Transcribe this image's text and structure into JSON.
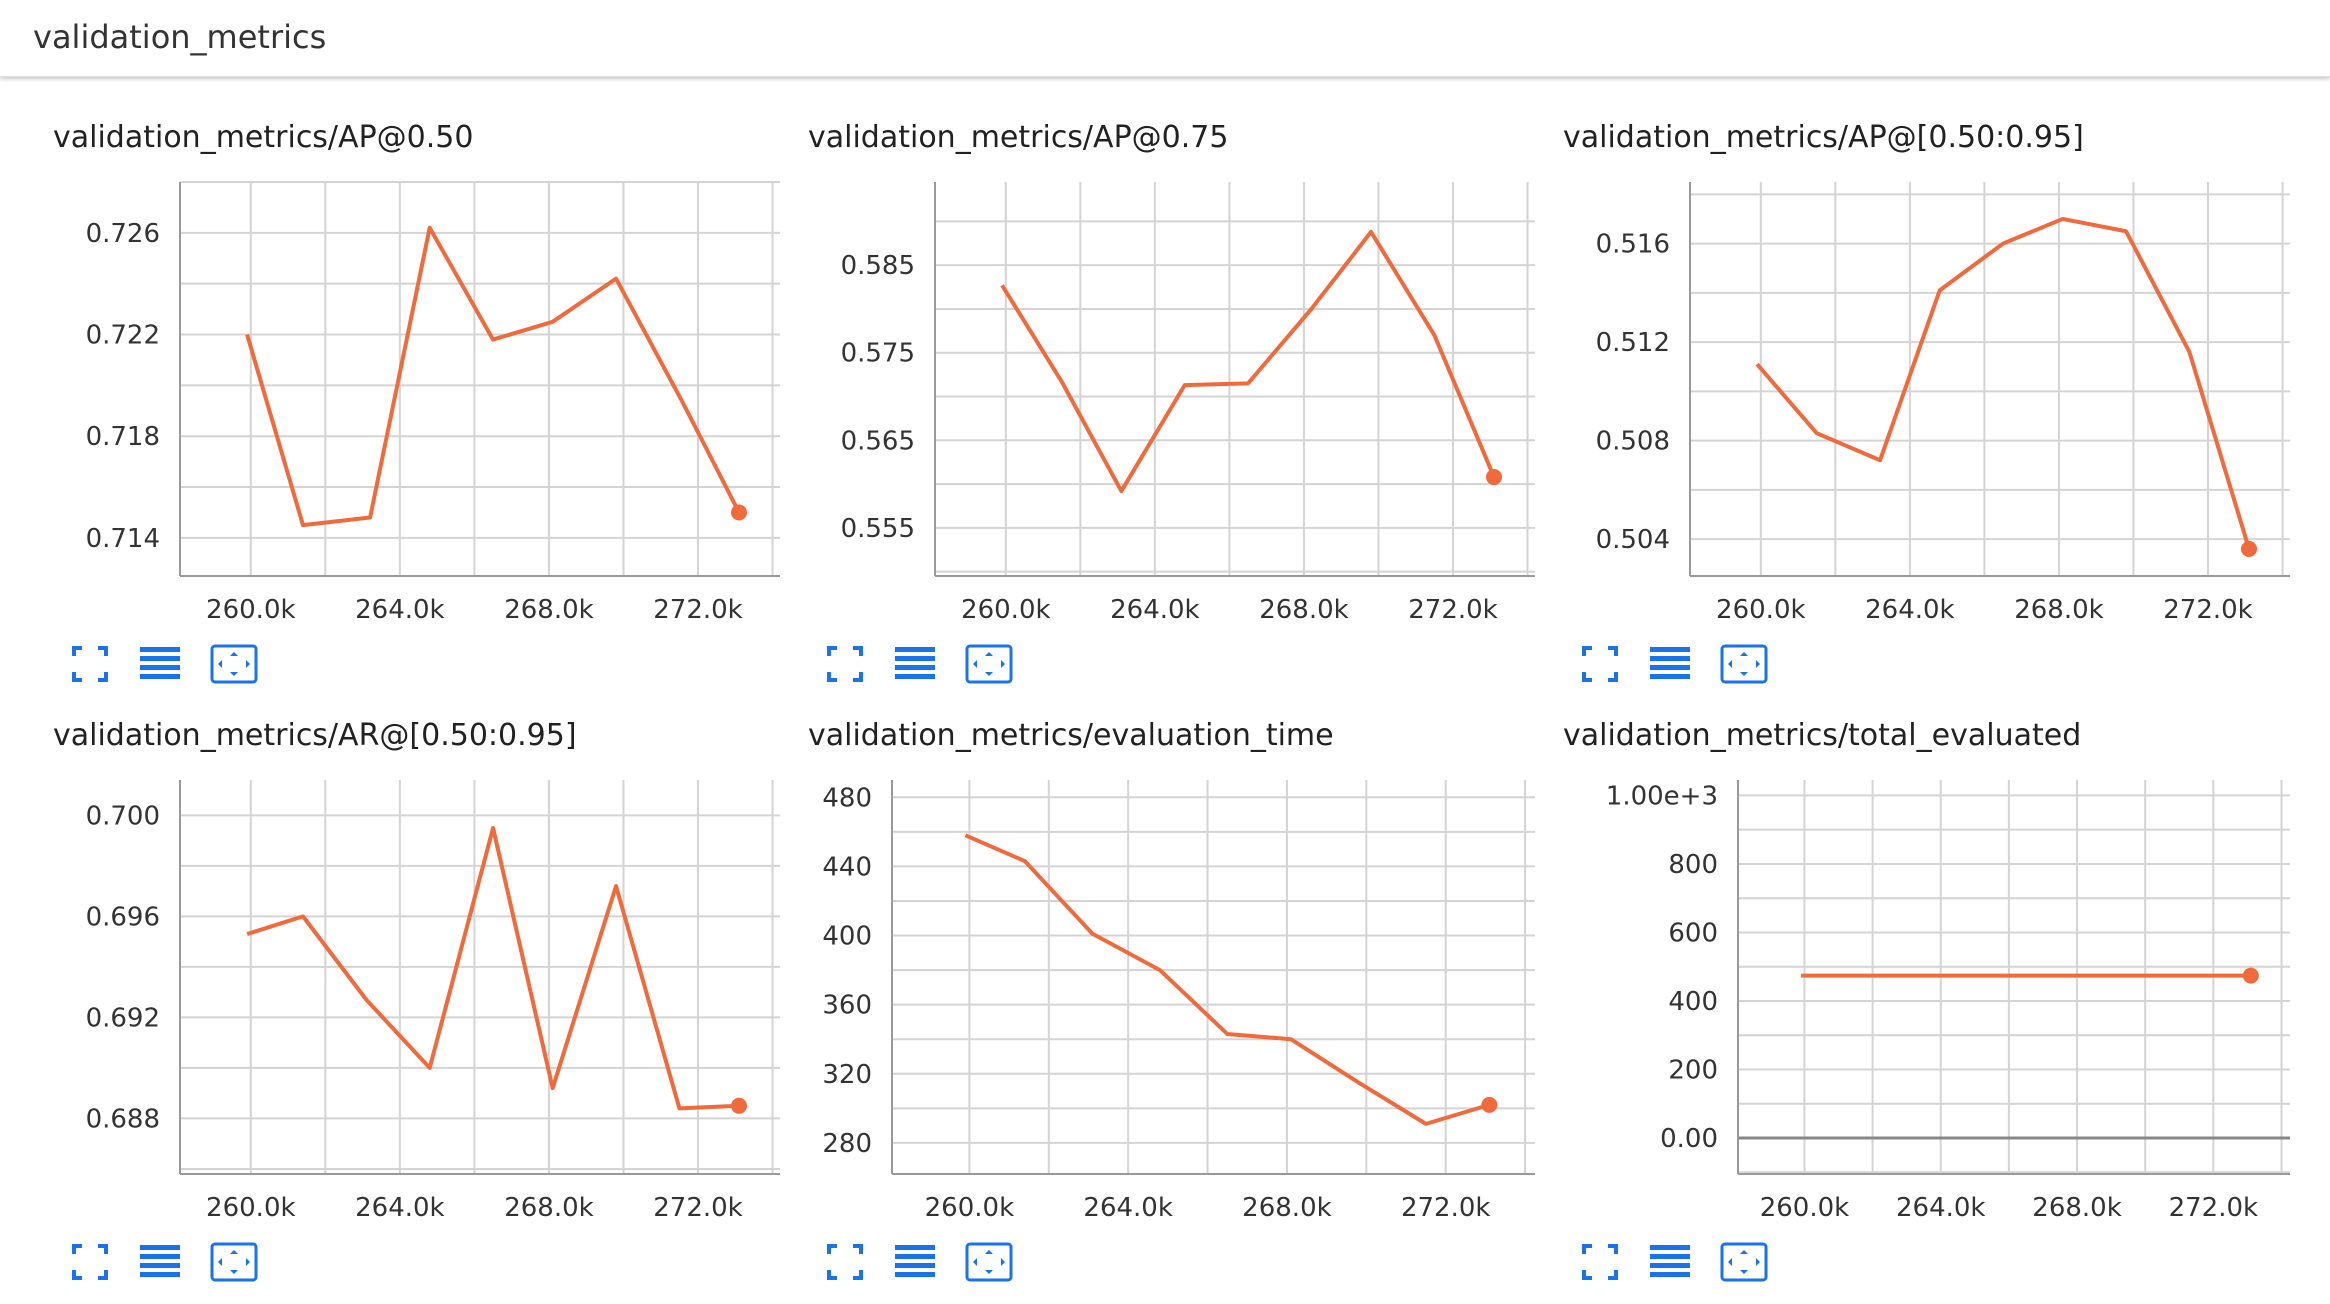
{
  "header": {
    "title": "validation_metrics"
  },
  "colors": {
    "line": "#f06a3c",
    "grid": "#d4d4d4",
    "axis": "#999999",
    "icon": "#1a73e8"
  },
  "toolbar_icons": [
    "fit-domain-icon",
    "data-table-icon",
    "expand-icon"
  ],
  "chart_data": [
    {
      "type": "line",
      "title": "validation_metrics/AP@0.50",
      "x_tick_labels": [
        "260.0k",
        "264.0k",
        "268.0k",
        "272.0k"
      ],
      "x_ticks": [
        260000,
        264000,
        268000,
        272000
      ],
      "y_tick_labels": [
        "0.714",
        "0.718",
        "0.722",
        "0.726"
      ],
      "y_ticks": [
        0.714,
        0.718,
        0.722,
        0.726
      ],
      "xlim": [
        258100,
        274200
      ],
      "ylim": [
        0.7125,
        0.728
      ],
      "series": [
        {
          "x": [
            259900,
            261400,
            263200,
            264800,
            266500,
            268100,
            269800,
            271600,
            273100
          ],
          "y": [
            0.722,
            0.7145,
            0.7148,
            0.7262,
            0.7218,
            0.7225,
            0.7242,
            0.7193,
            0.715
          ]
        }
      ]
    },
    {
      "type": "line",
      "title": "validation_metrics/AP@0.75",
      "x_tick_labels": [
        "260.0k",
        "264.0k",
        "268.0k",
        "272.0k"
      ],
      "x_ticks": [
        260000,
        264000,
        268000,
        272000
      ],
      "y_tick_labels": [
        "0.555",
        "0.565",
        "0.575",
        "0.585"
      ],
      "y_ticks": [
        0.555,
        0.565,
        0.575,
        0.585
      ],
      "xlim": [
        258100,
        274200
      ],
      "ylim": [
        0.5495,
        0.5945
      ],
      "series": [
        {
          "x": [
            259900,
            261500,
            263100,
            264800,
            266500,
            268200,
            269800,
            271500,
            273100
          ],
          "y": [
            0.5827,
            0.5717,
            0.5592,
            0.5713,
            0.5715,
            0.58,
            0.5888,
            0.577,
            0.5608
          ]
        }
      ]
    },
    {
      "type": "line",
      "title": "validation_metrics/AP@[0.50:0.95]",
      "x_tick_labels": [
        "260.0k",
        "264.0k",
        "268.0k",
        "272.0k"
      ],
      "x_ticks": [
        260000,
        264000,
        268000,
        272000
      ],
      "y_tick_labels": [
        "0.504",
        "0.508",
        "0.512",
        "0.516"
      ],
      "y_ticks": [
        0.504,
        0.508,
        0.512,
        0.516
      ],
      "xlim": [
        258100,
        274200
      ],
      "ylim": [
        0.5025,
        0.5185
      ],
      "series": [
        {
          "x": [
            259900,
            261500,
            263200,
            264800,
            266500,
            268100,
            269800,
            271500,
            273100
          ],
          "y": [
            0.5111,
            0.5083,
            0.5072,
            0.5141,
            0.516,
            0.517,
            0.5165,
            0.5116,
            0.5036
          ]
        }
      ]
    },
    {
      "type": "line",
      "title": "validation_metrics/AR@[0.50:0.95]",
      "x_tick_labels": [
        "260.0k",
        "264.0k",
        "268.0k",
        "272.0k"
      ],
      "x_ticks": [
        260000,
        264000,
        268000,
        272000
      ],
      "y_tick_labels": [
        "0.688",
        "0.692",
        "0.696",
        "0.700"
      ],
      "y_ticks": [
        0.688,
        0.692,
        0.696,
        0.7
      ],
      "xlim": [
        258100,
        274200
      ],
      "ylim": [
        0.6858,
        0.7014
      ],
      "series": [
        {
          "x": [
            259900,
            261400,
            263100,
            264800,
            266500,
            268100,
            269800,
            271500,
            273100
          ],
          "y": [
            0.6953,
            0.696,
            0.6927,
            0.69,
            0.6995,
            0.6892,
            0.6972,
            0.6884,
            0.6885
          ]
        }
      ]
    },
    {
      "type": "line",
      "title": "validation_metrics/evaluation_time",
      "x_tick_labels": [
        "260.0k",
        "264.0k",
        "268.0k",
        "272.0k"
      ],
      "x_ticks": [
        260000,
        264000,
        268000,
        272000
      ],
      "y_tick_labels": [
        "280",
        "320",
        "360",
        "400",
        "440",
        "480"
      ],
      "y_ticks": [
        280,
        320,
        360,
        400,
        440,
        480
      ],
      "xlim": [
        258050,
        274250
      ],
      "ylim": [
        262,
        490
      ],
      "series": [
        {
          "x": [
            259900,
            261400,
            263100,
            264800,
            266500,
            268100,
            269800,
            271500,
            273100
          ],
          "y": [
            458,
            443,
            401,
            380,
            343,
            340,
            315,
            291,
            302
          ]
        }
      ]
    },
    {
      "type": "line",
      "title": "validation_metrics/total_evaluated",
      "x_tick_labels": [
        "260.0k",
        "264.0k",
        "268.0k",
        "272.0k"
      ],
      "x_ticks": [
        260000,
        264000,
        268000,
        272000
      ],
      "y_tick_labels": [
        "0.00",
        "200",
        "400",
        "600",
        "800",
        "1.00e+3"
      ],
      "y_ticks": [
        0,
        200,
        400,
        600,
        800,
        1000
      ],
      "xlim": [
        258050,
        274250
      ],
      "ylim": [
        -105,
        1045
      ],
      "zero_line": true,
      "series": [
        {
          "x": [
            259900,
            273100
          ],
          "y": [
            474,
            474
          ]
        }
      ]
    }
  ]
}
